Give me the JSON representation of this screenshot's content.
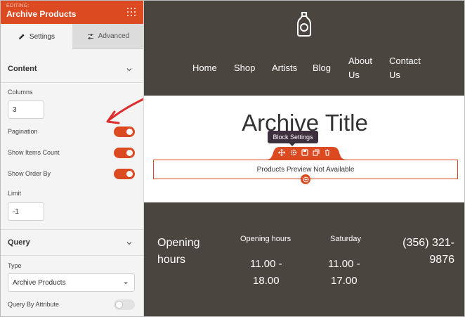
{
  "sidebar": {
    "editing_label": "EDITING:",
    "title": "Archive Products",
    "tabs": [
      {
        "label": "Settings",
        "icon": "pencil-icon",
        "active": true
      },
      {
        "label": "Advanced",
        "icon": "sliders-icon",
        "active": false
      }
    ],
    "content_section": {
      "title": "Content",
      "columns_label": "Columns",
      "columns_value": "3",
      "pagination_label": "Pagination",
      "pagination_on": true,
      "show_items_count_label": "Show Items Count",
      "show_items_count_on": true,
      "show_order_by_label": "Show Order By",
      "show_order_by_on": true,
      "limit_label": "Limit",
      "limit_value": "-1"
    },
    "query_section": {
      "title": "Query",
      "type_label": "Type",
      "type_value": "Archive Products",
      "query_by_attribute_label": "Query By Attribute",
      "query_by_attribute_on": false
    }
  },
  "canvas": {
    "nav": {
      "home": "Home",
      "shop": "Shop",
      "artists": "Artists",
      "blog": "Blog",
      "about_l1": "About",
      "about_l2": "Us",
      "contact_l1": "Contact",
      "contact_l2": "Us"
    },
    "archive_title": "Archive Title",
    "tooltip": "Block Settings",
    "preview_text": "Products Preview Not Available",
    "footer": {
      "opening_l1": "Opening",
      "opening_l2": "hours",
      "col1_heading": "Opening hours",
      "col1_l1": "11.00 -",
      "col1_l2": "18.00",
      "col2_heading": "Saturday",
      "col2_l1": "11.00 -",
      "col2_l2": "17.00",
      "phone_l1": "(356) 321-",
      "phone_l2": "9876"
    }
  },
  "colors": {
    "accent": "#dc4a22",
    "dark_bg": "#4b4540",
    "tooltip_bg": "#3d2f3e"
  }
}
